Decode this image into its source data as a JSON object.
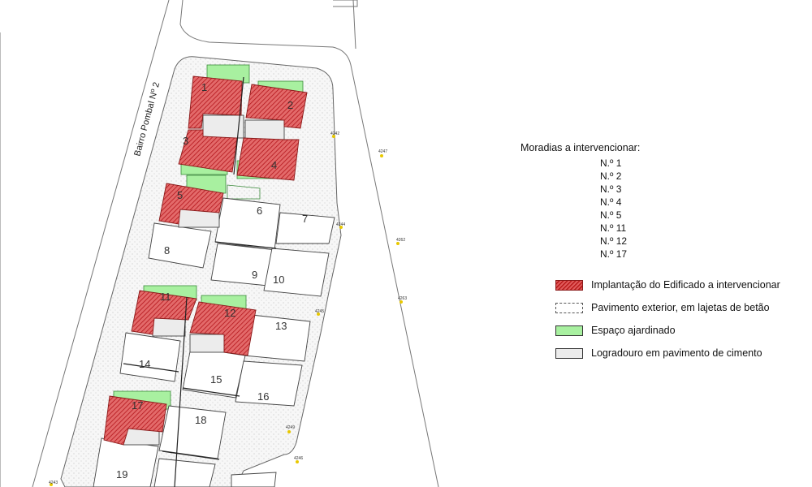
{
  "street_label": "Bairro Pombal Nº 2",
  "houses_title": "Moradias a intervencionar:",
  "houses": [
    "N.º 1",
    "N.º 2",
    "N.º 3",
    "N.º 4",
    "N.º 5",
    "N.º 11",
    "N.º 12",
    "N.º 17"
  ],
  "legend": [
    {
      "label": "Implantação do Edificado a intervencionar",
      "swatch": "red"
    },
    {
      "label": "Pavimento exterior, em lajetas de betão",
      "swatch": "paving"
    },
    {
      "label": "Espaço ajardinado",
      "swatch": "green"
    },
    {
      "label": "Logradouro em pavimento de cimento",
      "swatch": "grey"
    }
  ],
  "lot_numbers": [
    "1",
    "2",
    "3",
    "4",
    "5",
    "6",
    "7",
    "8",
    "9",
    "10",
    "11",
    "12",
    "13",
    "14",
    "15",
    "16",
    "17",
    "18",
    "19"
  ],
  "survey_points": [
    "4242",
    "4247",
    "4244",
    "4262",
    "4245",
    "4263",
    "4249",
    "4246",
    "4243"
  ],
  "colors": {
    "intervention": "#c0392b",
    "garden": "#a8f0a0",
    "yard": "#ececec",
    "survey_marker": "#e8c800"
  }
}
